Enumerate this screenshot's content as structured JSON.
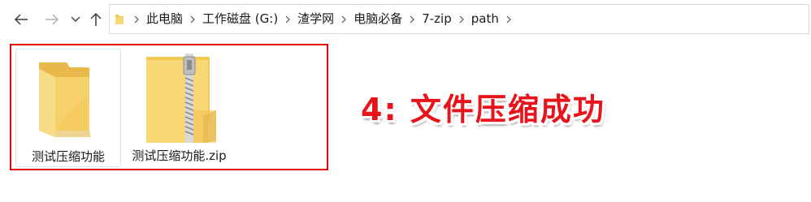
{
  "nav": {
    "back_icon": "arrow-left-icon",
    "forward_icon": "arrow-right-icon",
    "recent_icon": "chevron-down-icon",
    "up_icon": "arrow-up-icon"
  },
  "address_bar": {
    "root_icon": "folder-icon",
    "breadcrumbs": [
      "此电脑",
      "工作磁盘 (G:)",
      "渣学网",
      "电脑必备",
      "7-zip",
      "path"
    ]
  },
  "files": [
    {
      "name": "测试压缩功能",
      "icon": "folder-icon",
      "selected": true
    },
    {
      "name": "测试压缩功能.zip",
      "icon": "zip-folder-icon",
      "selected": false
    }
  ],
  "annotation": {
    "text": "4:  文件压缩成功",
    "color": "#e8141b"
  },
  "colors": {
    "highlight_border": "#e60012",
    "folder_yellow": "#f8d775",
    "selection_border": "#cce8ff"
  }
}
